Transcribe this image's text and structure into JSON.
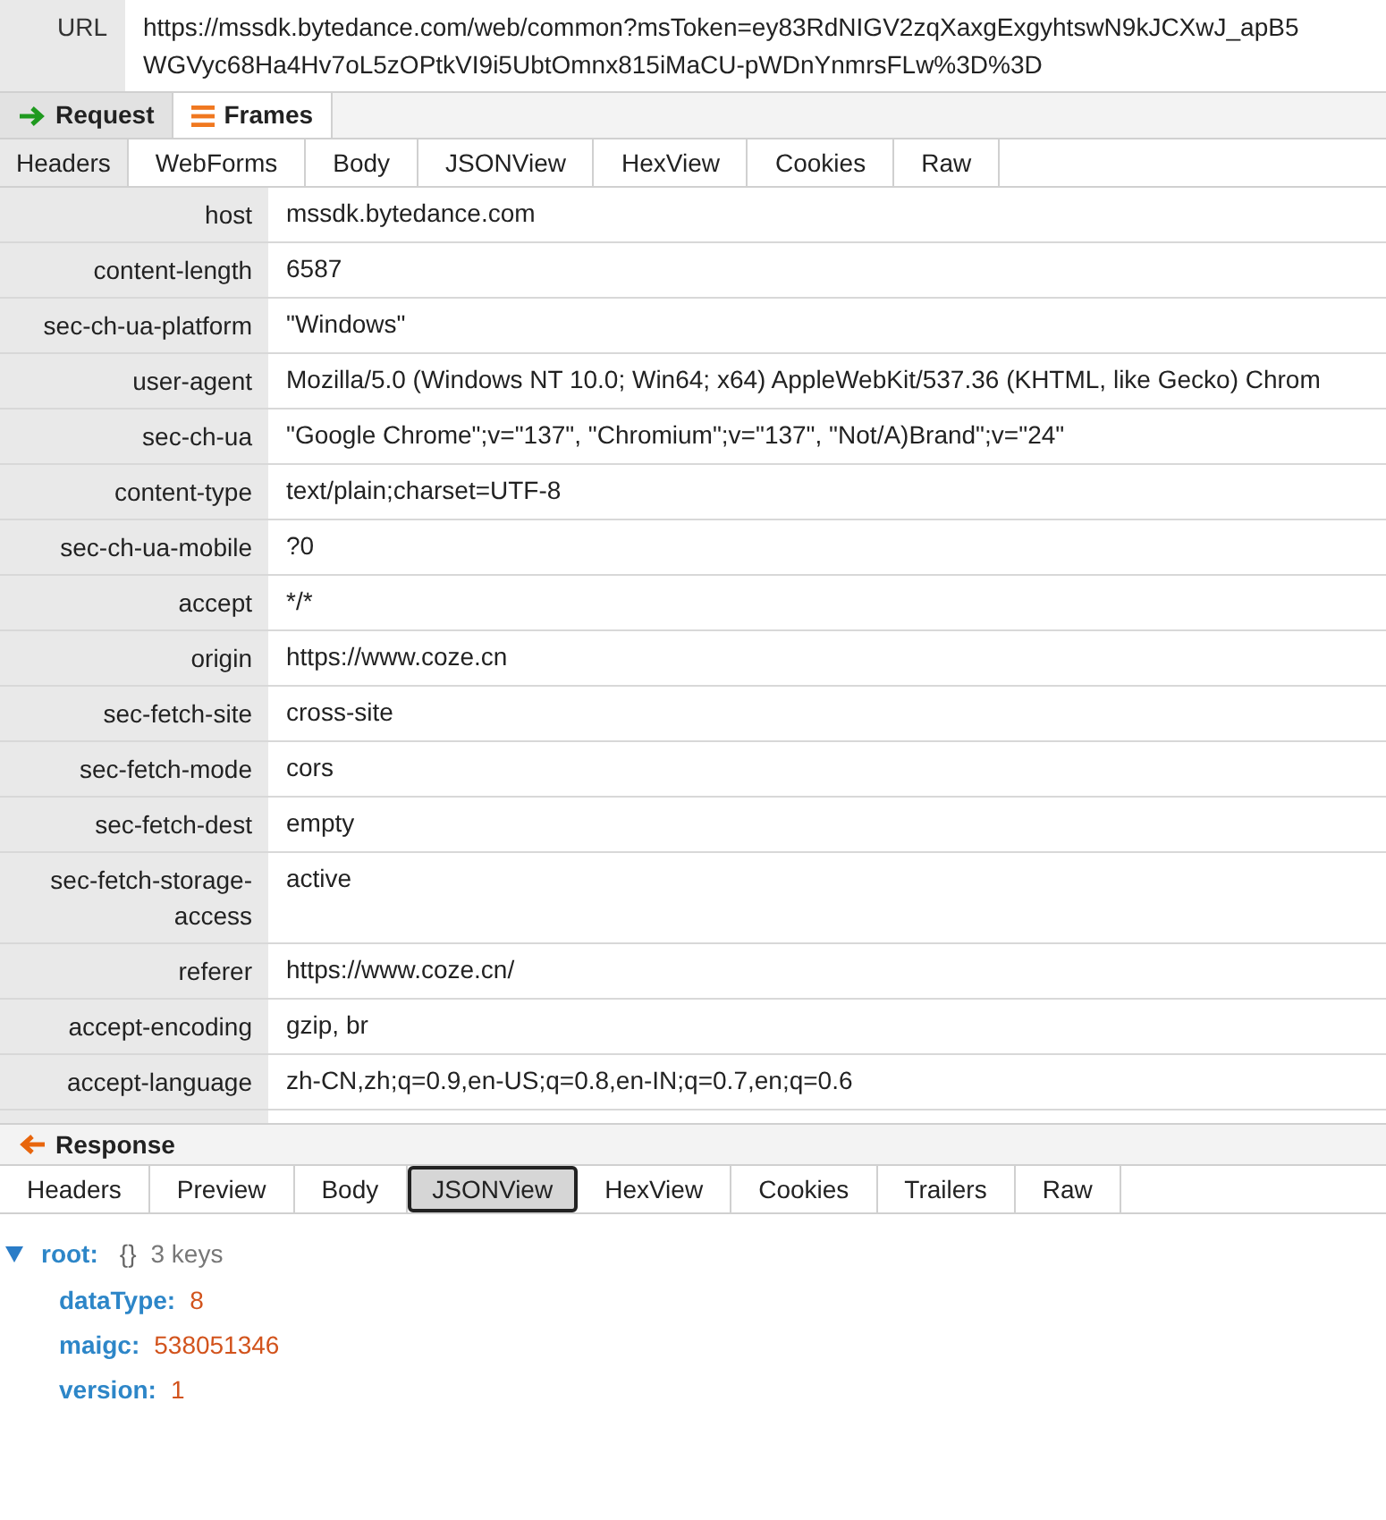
{
  "url": {
    "label": "URL",
    "lines": [
      "https://mssdk.bytedance.com/web/common?msToken=ey83RdNIGV2zqXaxgExgyhtswN9kJCXwJ_apB5",
      "WGVyc68Ha4Hv7oL5zOPtkVI9i5UbtOmnx815iMaCU-pWDnYnmrsFLw%3D%3D"
    ]
  },
  "request_bar": [
    {
      "label": "Request",
      "kind": "request",
      "selected": true
    },
    {
      "label": "Frames",
      "kind": "frames",
      "selected": false
    }
  ],
  "request_tabs": [
    {
      "label": "Headers",
      "selected": true
    },
    {
      "label": "WebForms",
      "selected": false
    },
    {
      "label": "Body",
      "selected": false
    },
    {
      "label": "JSONView",
      "selected": false
    },
    {
      "label": "HexView",
      "selected": false
    },
    {
      "label": "Cookies",
      "selected": false
    },
    {
      "label": "Raw",
      "selected": false
    }
  ],
  "headers": [
    {
      "name": "host",
      "value": "mssdk.bytedance.com"
    },
    {
      "name": "content-length",
      "value": "6587"
    },
    {
      "name": "sec-ch-ua-platform",
      "value": "\"Windows\""
    },
    {
      "name": "user-agent",
      "value": "Mozilla/5.0 (Windows NT 10.0; Win64; x64) AppleWebKit/537.36 (KHTML, like Gecko) Chrom"
    },
    {
      "name": "sec-ch-ua",
      "value": "\"Google Chrome\";v=\"137\", \"Chromium\";v=\"137\", \"Not/A)Brand\";v=\"24\""
    },
    {
      "name": "content-type",
      "value": "text/plain;charset=UTF-8"
    },
    {
      "name": "sec-ch-ua-mobile",
      "value": "?0"
    },
    {
      "name": "accept",
      "value": "*/*"
    },
    {
      "name": "origin",
      "value": "https://www.coze.cn"
    },
    {
      "name": "sec-fetch-site",
      "value": "cross-site"
    },
    {
      "name": "sec-fetch-mode",
      "value": "cors"
    },
    {
      "name": "sec-fetch-dest",
      "value": "empty"
    },
    {
      "name": "sec-fetch-storage-access",
      "value": "active"
    },
    {
      "name": "referer",
      "value": "https://www.coze.cn/"
    },
    {
      "name": "accept-encoding",
      "value": "gzip, br"
    },
    {
      "name": "accept-language",
      "value": "zh-CN,zh;q=0.9,en-US;q=0.8,en-IN;q=0.7,en;q=0.6"
    }
  ],
  "response_bar": {
    "label": "Response"
  },
  "response_tabs": [
    {
      "label": "Headers",
      "selected": false
    },
    {
      "label": "Preview",
      "selected": false
    },
    {
      "label": "Body",
      "selected": false
    },
    {
      "label": "JSONView",
      "selected": true
    },
    {
      "label": "HexView",
      "selected": false
    },
    {
      "label": "Cookies",
      "selected": false
    },
    {
      "label": "Trailers",
      "selected": false
    },
    {
      "label": "Raw",
      "selected": false
    }
  ],
  "json_tree": {
    "key": "root:",
    "expanded": true,
    "braces": "{}",
    "summary": "3 keys",
    "children": [
      {
        "key": "dataType:",
        "value": "8"
      },
      {
        "key": "maigc:",
        "value": "538051346"
      },
      {
        "key": "version:",
        "value": "1"
      }
    ]
  }
}
